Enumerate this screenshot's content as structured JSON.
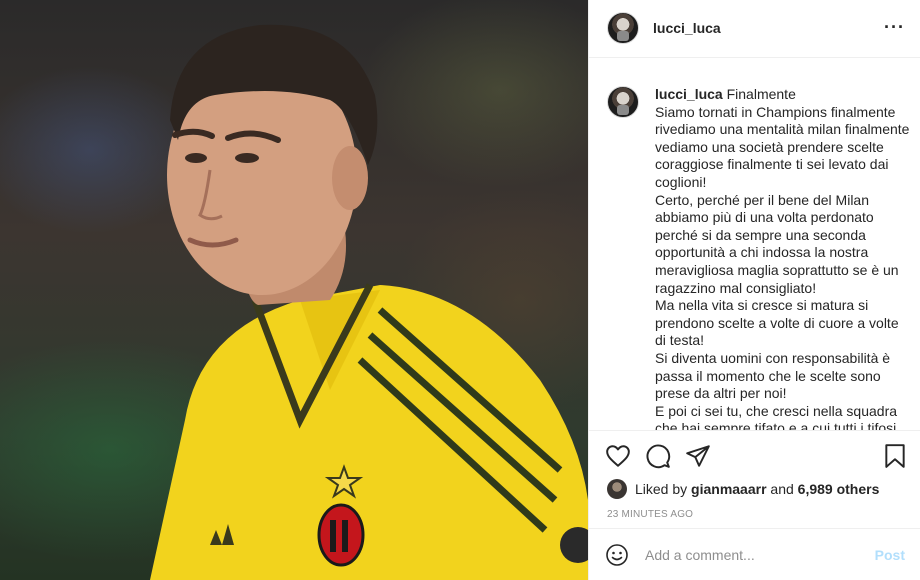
{
  "post": {
    "username": "lucci_luca",
    "more_label": "···",
    "caption_intro": "Finalmente",
    "caption_body": "Siamo tornati in Champions finalmente rivediamo una mentalità milan finalmente vediamo una società prendere scelte coraggiose finalmente ti sei levato dai coglioni!\nCerto, perché per il bene del Milan abbiamo più di una volta perdonato perché si da sempre una seconda opportunità a chi indossa la nostra meravigliosa maglia soprattutto se è un ragazzino mal consigliato!\nMa nella vita si cresce si matura si prendono scelte a volte di cuore a volte di testa!\nSi diventa uomini con responsabilità è passa il momento che le scelte sono prese da altri per noi!\nE poi ci sei tu, che cresci nella squadra che hai sempre tifato e a cui tutti i tifosi volevano bene",
    "likes": {
      "prefix": "Liked by",
      "user": "gianmaaarr",
      "connector": "and",
      "others": "6,989 others"
    },
    "timestamp": "23 MINUTES AGO"
  },
  "comment_box": {
    "placeholder": "Add a comment...",
    "post_label": "Post"
  },
  "icons": [
    "heart-icon",
    "comment-icon",
    "share-icon",
    "bookmark-icon",
    "emoji-icon",
    "more-icon"
  ],
  "colors": {
    "jersey": "#f2d31d",
    "jersey_stripes": "#2f3a1a",
    "post_button_disabled": "#b2dffc",
    "muted_text": "#8e8e8e"
  }
}
